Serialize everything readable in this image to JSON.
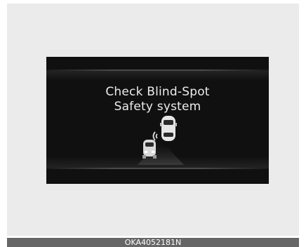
{
  "display": {
    "line1": "Check Blind-Spot",
    "line2": "Safety system"
  },
  "graphic": {
    "icon": "blind-spot-vehicles-icon"
  },
  "caption": "OKA4052181N"
}
